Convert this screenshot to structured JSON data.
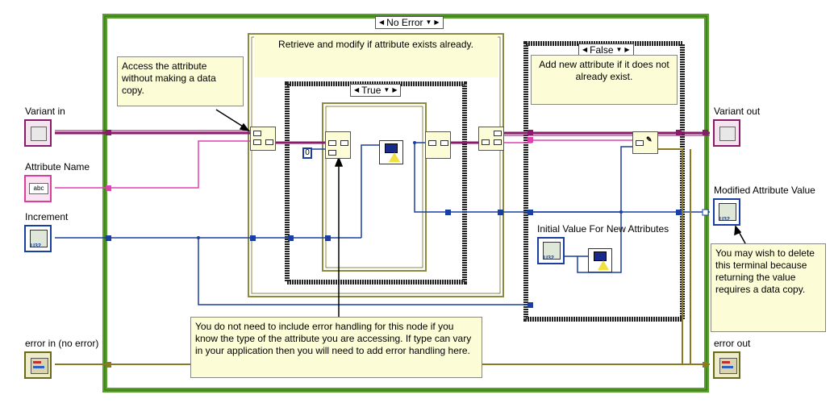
{
  "outer_case": {
    "selector": "No Error"
  },
  "ipe_structure": {
    "title": "Retrieve and modify if attribute exists already."
  },
  "inner_case": {
    "selector": "True"
  },
  "false_case": {
    "selector": "False",
    "title": "Add new attribute if it does not already exist."
  },
  "terminals": {
    "variant_in": "Variant in",
    "attribute_name": "Attribute Name",
    "attribute_name_icon": "abc",
    "increment": "Increment",
    "error_in": "error in (no error)",
    "variant_out": "Variant out",
    "modified_value": "Modified Attribute Value",
    "error_out": "error out",
    "initial_value": "Initial Value For New Attributes",
    "u32": "U32"
  },
  "constant_zero": "0",
  "notes": {
    "access": "Access the attribute without making a data copy.",
    "error_handling": "You do not need to include error handling for this node if you know the type of the attribute you are accessing. If type can vary in your application then you will need to add error handling here.",
    "delete_terminal": "You may wish to delete this terminal because returning the value requires a data copy."
  },
  "colors": {
    "frame_green": "#5aa02c",
    "case_black": "#222222",
    "variant_wire": "#8a1a6a",
    "string_wire": "#e040b0",
    "numeric_wire": "#1b3fa0",
    "error_wire": "#8a7a20",
    "note_bg": "#fcfcd6"
  },
  "icons": [
    "variant-icon",
    "string-icon",
    "numeric-icon",
    "error-cluster-icon",
    "increment-icon",
    "add-icon"
  ]
}
